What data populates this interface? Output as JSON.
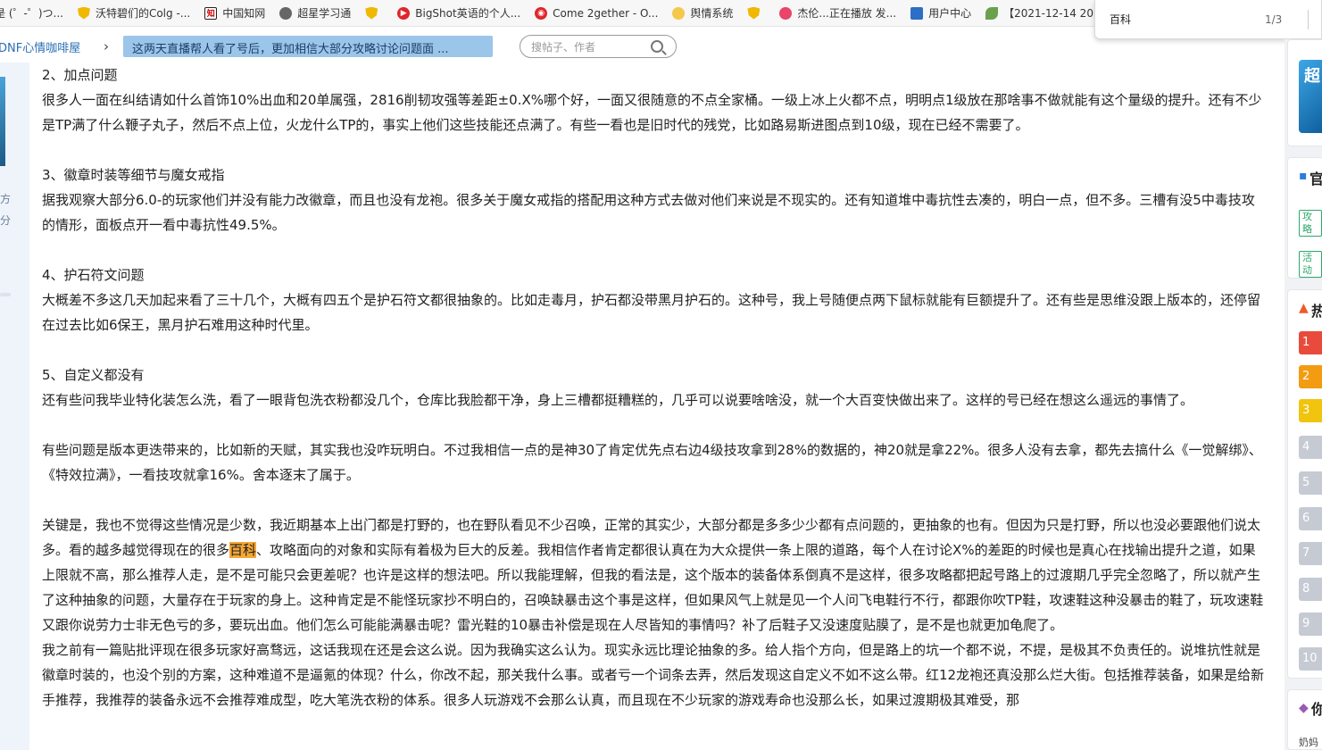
{
  "bookmarks": [
    {
      "label": "是 (゜-゜)つ...",
      "icon": "none"
    },
    {
      "label": "沃特碧们的Colg -...",
      "icon": "shield-icon"
    },
    {
      "label": "中国知网",
      "icon": "zhiwang-icon"
    },
    {
      "label": "超星学习通",
      "icon": "globe-icon"
    },
    {
      "label": "",
      "icon": "shield-icon"
    },
    {
      "label": "BigShot英语的个人...",
      "icon": "record-icon"
    },
    {
      "label": "Come 2gether - O...",
      "icon": "netease-icon"
    },
    {
      "label": "舆情系统",
      "icon": "face-icon"
    },
    {
      "label": "",
      "icon": "shield-icon"
    },
    {
      "label": "杰伦...正在播放 发...",
      "icon": "bilibili-icon"
    },
    {
      "label": "用户中心",
      "icon": "user-icon"
    },
    {
      "label": "【2021-12-14 20...",
      "icon": "leaf-icon"
    }
  ],
  "find_bar": {
    "query": "百科",
    "count": "1/3"
  },
  "breadcrumb": {
    "forum": "DNF心情咖啡屋",
    "separator": "›",
    "thread_title": "这两天直播帮人看了号后，更加相信大部分攻略讨论问题面 ..."
  },
  "search": {
    "placeholder": "搜帖子、作者"
  },
  "left_strip": {
    "chars": [
      "方",
      "分"
    ]
  },
  "article": {
    "paragraphs": [
      {
        "lines": [
          "2、加点问题",
          "很多人一面在纠结请如什么首饰10%出血和20单属强，2816削韧攻强等差距±0.X%哪个好，一面又很随意的不点全家桶。一级上冰上火都不点，明明点1级放在那啥事不做就能有这个量级的提升。还有不少是TP满了什么鞭子丸子，然后不点上位，火龙什么TP的，事实上他们这些技能还点满了。有些一看也是旧时代的残党，比如路易斯进图点到10级，现在已经不需要了。"
        ]
      },
      {
        "lines": [
          "3、徽章时装等细节与魔女戒指",
          "据我观察大部分6.0-的玩家他们并没有能力改徽章，而且也没有龙袍。很多关于魔女戒指的搭配用这种方式去做对他们来说是不现实的。还有知道堆中毒抗性去凑的，明白一点，但不多。三槽有没5中毒技攻的情形，面板点开一看中毒抗性49.5%。"
        ]
      },
      {
        "lines": [
          "4、护石符文问题",
          "大概差不多这几天加起来看了三十几个，大概有四五个是护石符文都很抽象的。比如走毒月，护石都没带黑月护石的。这种号，我上号随便点两下鼠标就能有巨额提升了。还有些是思维没跟上版本的，还停留在过去比如6保王，黑月护石难用这种时代里。"
        ]
      },
      {
        "lines": [
          "5、自定义都没有",
          "还有些问我毕业特化装怎么洗，看了一眼背包洗衣粉都没几个，仓库比我脸都干净，身上三槽都挺糟糕的，几乎可以说要啥啥没，就一个大百变快做出来了。这样的号已经在想这么遥远的事情了。"
        ]
      },
      {
        "lines": [
          "有些问题是版本更迭带来的，比如新的天赋，其实我也没咋玩明白。不过我相信一点的是神30了肯定优先点右边4级技攻拿到28%的数据的，神20就是拿22%。很多人没有去拿，都先去搞什么《一觉解绑》、《特效拉满》，一看技攻就拿16%。舍本逐末了属于。"
        ]
      }
    ],
    "key_paragraph": {
      "before": "关键是，我也不觉得这些情况是少数，我近期基本上出门都是打野的，也在野队看见不少召唤，正常的其实少，大部分都是多多少少都有点问题的，更抽象的也有。但因为只是打野，所以也没必要跟他们说太多。看的越多越觉得现在的很多",
      "highlight": "百科",
      "after": "、攻略面向的对象和实际有着极为巨大的反差。我相信作者肯定都很认真在为大众提供一条上限的道路，每个人在讨论X%的差距的时候也是真心在找输出提升之道，如果上限就不高，那么推荐人走，是不是可能只会更差呢？也许是这样的想法吧。所以我能理解，但我的看法是，这个版本的装备体系倒真不是这样，很多攻略都把起号路上的过渡期几乎完全忽略了，所以就产生了这种抽象的问题，大量存在于玩家的身上。这种肯定是不能怪玩家抄不明白的，召唤缺暴击这个事是这样，但如果风气上就是见一个人问飞电鞋行不行，都跟你吹TP鞋，攻速鞋这种没暴击的鞋了，玩攻速鞋又跟你说劳力士非无色亏的多，要玩出血。他们怎么可能能满暴击呢？雷光鞋的10暴击补偿是现在人尽皆知的事情吗？补了后鞋子又没速度贴膜了，是不是也就更加龟爬了。"
    },
    "last_paragraph": "我之前有一篇贴批评现在很多玩家好高骛远，这话我现在还是会这么说。因为我确实这么认为。现实永远比理论抽象的多。给人指个方向，但是路上的坑一个都不说，不提，是极其不负责任的。说堆抗性就是徽章时装的，也没个别的方案，这种难道不是逼氪的体现？什么，你改不起，那关我什么事。或者亏一个词条去弄，然后发现这自定义不如不这么带。红12龙袍还真没那么烂大街。包括推荐装备，如果是给新手推荐，我推荐的装备永远不会推荐难成型，吃大笔洗衣粉的体系。很多人玩游戏不会那么认真，而且现在不少玩家的游戏寿命也没那么长，如果过渡期极其难受，那"
  },
  "sidebar": {
    "banner_char": "超",
    "sections": [
      "官",
      "热"
    ],
    "tags": [
      "攻略",
      "活动"
    ],
    "ranks": [
      "1",
      "2",
      "3",
      "4",
      "5",
      "6",
      "7",
      "8",
      "9",
      "10"
    ],
    "footer_head": "你",
    "footer_note": "奶妈"
  },
  "colors": {
    "link": "#2a6fb5",
    "highlight": "#f6a735",
    "crumb_bg": "#9cc5ea"
  }
}
